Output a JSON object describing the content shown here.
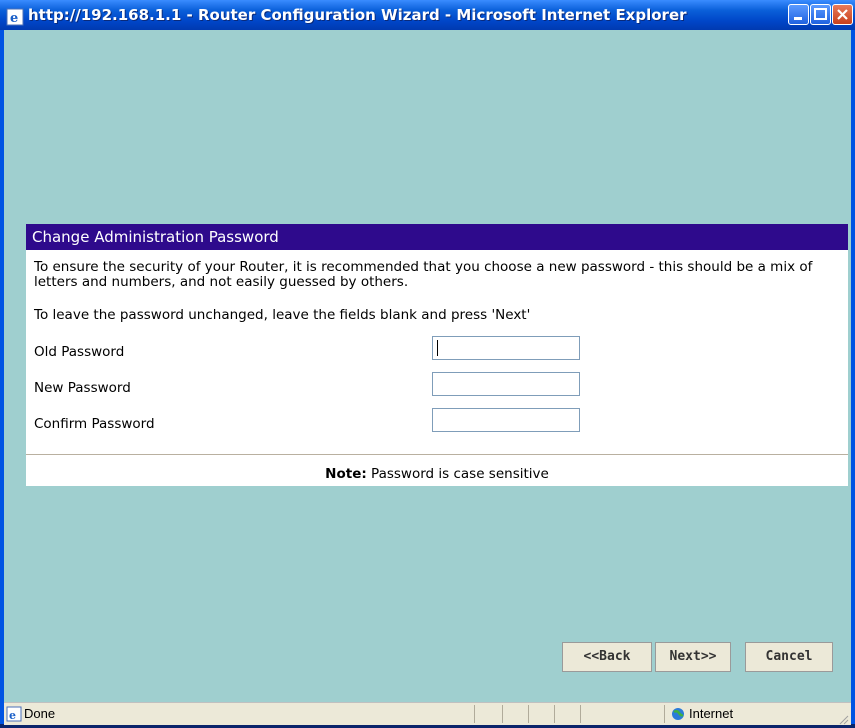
{
  "window": {
    "title": "http://192.168.1.1 - Router Configuration Wizard - Microsoft Internet Explorer",
    "controls": [
      "minimize-icon",
      "maximize-icon",
      "close-icon"
    ]
  },
  "panel": {
    "header": "Change Administration Password",
    "intro": "To ensure the security of your Router, it is recommended that you choose a new password - this should be a mix of letters and numbers, and not easily guessed by others.",
    "instruction": "To leave the password unchanged, leave the fields blank and press 'Next'",
    "fields": [
      {
        "label": "Old Password",
        "value": ""
      },
      {
        "label": "New Password",
        "value": ""
      },
      {
        "label": "Confirm Password",
        "value": ""
      }
    ],
    "note_label": "Note:",
    "note_text": " Password is case sensitive"
  },
  "buttons": {
    "back": "<<Back",
    "next": "Next>>",
    "cancel": "Cancel"
  },
  "status": {
    "left": "Done",
    "zone": "Internet"
  },
  "colors": {
    "page_bg": "#9fcfcf",
    "panel_header_bg": "#2e0a8c",
    "titlebar": "#0054e3"
  }
}
